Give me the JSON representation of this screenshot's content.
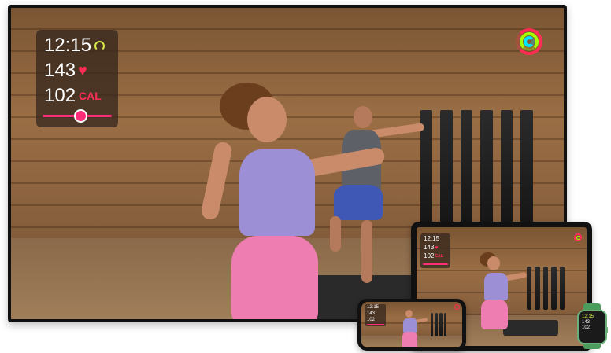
{
  "metrics": {
    "time": "12:15",
    "heart_rate": "143",
    "heart_symbol": "♥",
    "calories": "102",
    "calories_unit": "CAL"
  },
  "colors": {
    "accent_pink": "#ff2d7a",
    "heart_red": "#ff2d55",
    "timer_ring": "#d7e84a",
    "ring_move": "#ff2d55",
    "ring_exercise": "#a6ff00",
    "ring_stand": "#00e5ff"
  },
  "icons": {
    "timer": "timer-ring-icon",
    "heart": "heart-icon",
    "activity": "activity-rings-icon",
    "scrubber": "workout-progress-icon"
  },
  "devices": [
    "tv",
    "ipad",
    "iphone",
    "watch"
  ]
}
